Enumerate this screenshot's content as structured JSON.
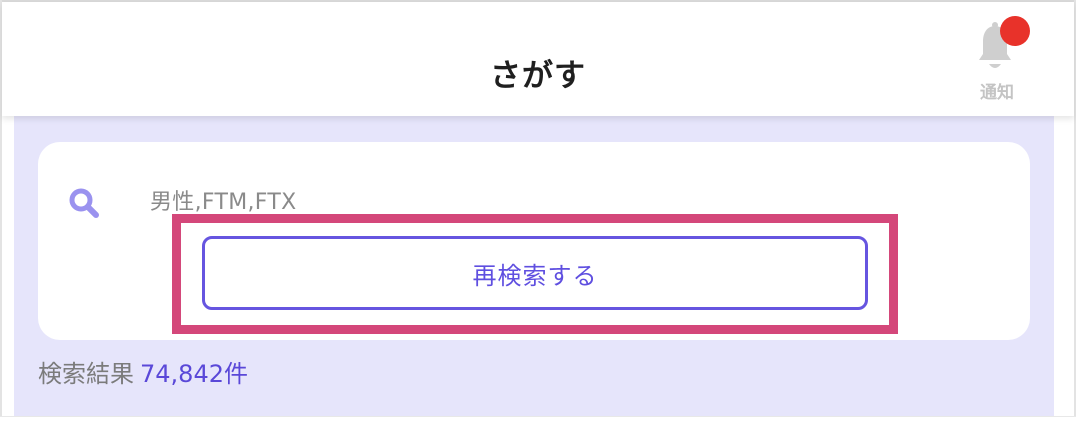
{
  "header": {
    "title": "さがす",
    "notification_label": "通知"
  },
  "search": {
    "query_text": "男性,FTM,FTX",
    "button_label": "再検索する"
  },
  "results": {
    "label": "検索結果",
    "count": "74,842件"
  },
  "colors": {
    "accent": "#5f4fe0",
    "highlight": "#d4477a",
    "panel_bg": "#e6e5fb",
    "notification_dot": "#e8322a"
  },
  "icons": {
    "search": "search-icon",
    "bell": "bell-icon"
  }
}
